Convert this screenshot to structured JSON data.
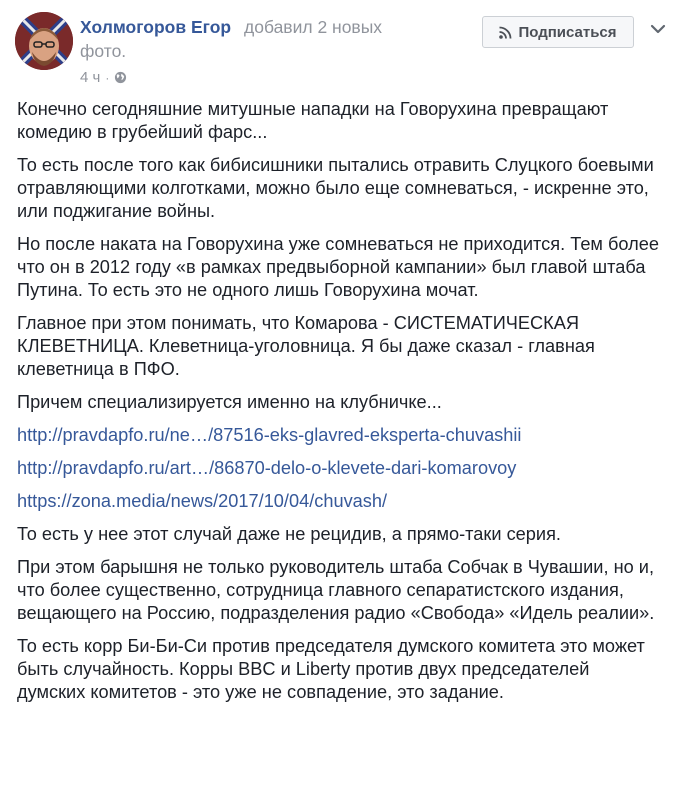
{
  "post": {
    "author_name": "Холмогоров Егор",
    "action_text_1": "добавил 2 новых",
    "action_text_2": "фото.",
    "time": "4 ч",
    "time_separator": "·",
    "privacy_icon": "globe-icon",
    "subscribe_label": "Подписаться",
    "subscribe_icon": "rss-icon",
    "menu_icon": "chevron-down-icon",
    "paragraphs": [
      "Конечно сегодняшние митушные нападки на Говорухина превращают комедию в грубейший фарс...",
      "То есть после того как бибисишники пытались отравить Слуцкого боевыми отравляющими колготками, можно было еще сомневаться, - искренне это, или поджигание войны.",
      "Но после наката на Говорухина уже сомневаться не приходится. Тем более что он в 2012 году «в рамках предвыборной кампании» был главой штаба Путина. То есть это не одного лишь Говорухина мочат.",
      "Главное при этом понимать, что Комарова - СИСТЕМАТИЧЕСКАЯ КЛЕВЕТНИЦА. Клеветница-уголовница. Я бы даже сказал - главная клеветница в ПФО.",
      "Причем специализируется именно на клубничке..."
    ],
    "links": [
      "http://pravdapfo.ru/ne…/87516-eks-glavred-eksperta-chuvashii",
      "http://pravdapfo.ru/art…/86870-delo-o-klevete-dari-komarovoy",
      "https://zona.media/news/2017/10/04/chuvash/"
    ],
    "paragraphs_after": [
      "То есть у нее этот случай даже не рецидив, а прямо-таки серия.",
      "При этом барышня не только руководитель штаба Собчак в Чувашии, но и, что более существенно, сотрудница главного сепаратистского издания, вещающего на Россию, подразделения радио «Свобода» «Идель реалии».",
      "То есть корр Би-Би-Си против председателя думского комитета это может быть случайность. Корры BBC и Liberty против двух председателей думских комитетов - это уже не совпадение, это задание."
    ]
  },
  "colors": {
    "link": "#365899",
    "text": "#1d2129",
    "meta": "#90949c",
    "button_bg": "#f6f7f9",
    "button_border": "#ccd0d5"
  }
}
